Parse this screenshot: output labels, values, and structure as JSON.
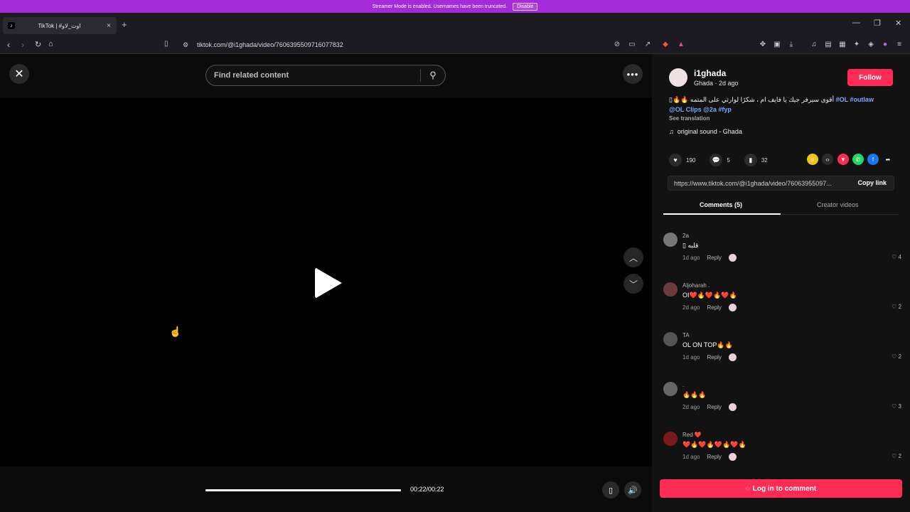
{
  "banner": {
    "message": "Streamer Mode is enabled. Usernames have been truncated.",
    "disable_label": "Disable"
  },
  "tab": {
    "title": "TikTok | #اوت_لاو",
    "favicon": "tiktok-icon"
  },
  "address": {
    "url": "tiktok.com/@i1ghada/video/7606395509716077832"
  },
  "video": {
    "search_placeholder": "Find related content",
    "time": "00:22/00:22",
    "progress": 1.0
  },
  "author": {
    "username": "i1ghada",
    "subline": "Ghada · 2d ago",
    "follow_label": "Follow",
    "caption_text": "أقوى سيرفر جيك يا فايف ام ، شكرًا لوارثي على المتمه 🔥🔥▯",
    "caption_tags": "#OL #outlaw",
    "caption_line2": "@OL Clips @2a #fyp",
    "see_translation": "See translation",
    "sound": "original sound - Ghada"
  },
  "stats": {
    "likes": "190",
    "comments": "5",
    "saves": "32"
  },
  "share": {
    "link": "https://www.tiktok.com/@i1ghada/video/76063955097...",
    "copy_label": "Copy link"
  },
  "tabs": {
    "comments": "Comments (5)",
    "creator_videos": "Creator videos"
  },
  "comments": [
    {
      "name": "2a",
      "text": "▯ قلبه",
      "time": "1d ago",
      "reply": "Reply",
      "likes": "4",
      "avatar": "#777"
    },
    {
      "name": "Aljoharah .",
      "text": "OI❤️🔥❤️🔥❤️🔥",
      "time": "2d ago",
      "reply": "Reply",
      "likes": "2",
      "avatar": "#6b3b3b"
    },
    {
      "name": "TA",
      "text": "OL ON TOP🔥🔥",
      "time": "1d ago",
      "reply": "Reply",
      "likes": "2",
      "avatar": "#555"
    },
    {
      "name": ".",
      "text": "🔥🔥🔥",
      "time": "2d ago",
      "reply": "Reply",
      "likes": "3",
      "avatar": "#666"
    },
    {
      "name": "Red ❤️",
      "text": "❤️🔥❤️🔥❤️🔥❤️🔥",
      "time": "1d ago",
      "reply": "Reply",
      "likes": "2",
      "avatar": "#7a1a1a"
    }
  ],
  "login_cta": "Log in to comment",
  "colors": {
    "accent": "#fe2c55",
    "banner": "#a42bd9",
    "tag": "#7aa7ff"
  }
}
